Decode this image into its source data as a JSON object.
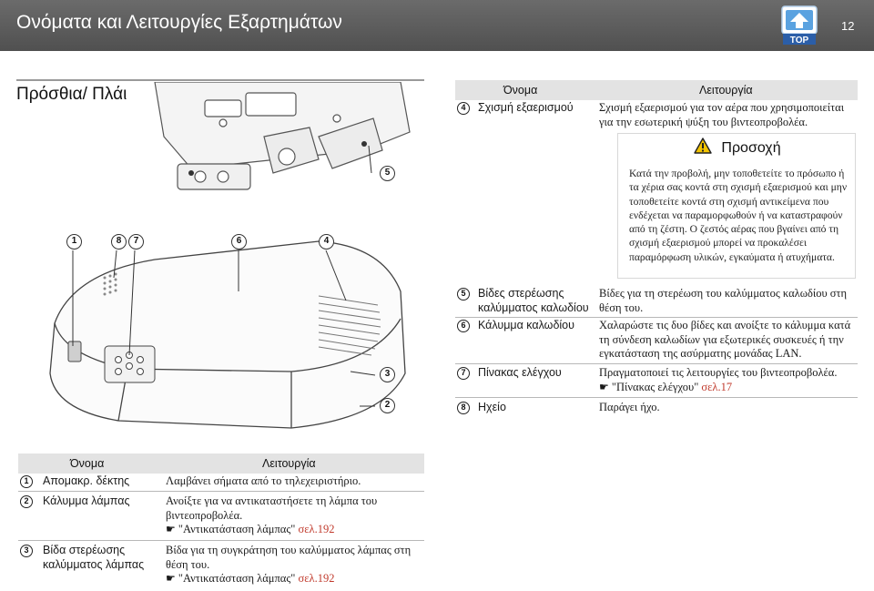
{
  "header": {
    "title": "Ονόματα και Λειτουργίες Εξαρτημάτων",
    "page_number": "12",
    "top_button_label": "TOP",
    "top_icon": "top-arrow-icon"
  },
  "section": {
    "title": "Πρόσθια/ Πλάι"
  },
  "figure": {
    "callouts": [
      "1",
      "8",
      "7",
      "6",
      "4",
      "5",
      "3",
      "2"
    ]
  },
  "right_table": {
    "header_name": "Όνομα",
    "header_function": "Λειτουργία",
    "rows": [
      {
        "num": "4",
        "name": "Σχισμή εξαερισμού",
        "func": "Σχισμή εξαερισμού για τον αέρα που χρησιμοποιείται για την εσωτερική ψύξη του βιντεοπροβολέα."
      },
      {
        "num": "5",
        "name": "Βίδες στερέωσης καλύμματος καλωδίου",
        "func": "Βίδες για τη στερέωση του καλύμματος καλωδίου στη θέση του."
      },
      {
        "num": "6",
        "name": "Κάλυμμα καλωδίου",
        "func": "Χαλαρώστε τις δυο βίδες και ανοίξτε το κάλυμμα κατά τη σύνδεση καλωδίων για εξωτερικές συσκευές ή την εγκατάσταση της ασύρματης μονάδας LAN."
      },
      {
        "num": "7",
        "name": "Πίνακας ελέγχου",
        "func": "Πραγματοποιεί τις λειτουργίες του βιντεοπροβολέα.",
        "ref_text": "\"Πίνακας ελέγχου\"",
        "ref_link": "σελ.17"
      },
      {
        "num": "8",
        "name": "Ηχείο",
        "func": "Παράγει ήχο."
      }
    ]
  },
  "caution": {
    "title": "Προσοχή",
    "icon": "warning-triangle-icon",
    "text": "Κατά την προβολή, μην τοποθετείτε το πρόσωπο ή τα χέρια σας κοντά στη σχισμή εξαερισμού και μην τοποθετείτε κοντά στη σχισμή αντικείμενα που ενδέχεται να παραμορφωθούν ή να καταστραφούν από τη ζέστη. Ο ζεστός αέρας που βγαίνει από τη σχισμή εξαερισμού μπορεί να προκαλέσει παραμόρφωση υλικών, εγκαύματα ή ατυχήματα."
  },
  "bottom_table": {
    "header_name": "Όνομα",
    "header_function": "Λειτουργία",
    "rows": [
      {
        "num": "1",
        "name": "Απομακρ. δέκτης",
        "func": "Λαμβάνει σήματα από το τηλεχειριστήριο."
      },
      {
        "num": "2",
        "name": "Κάλυμμα λάμπας",
        "func": "Ανοίξτε για να αντικαταστήσετε τη λάμπα του βιντεοπροβολέα.",
        "ref_text": "\"Αντικατάσταση λάμπας\"",
        "ref_link": "σελ.192"
      },
      {
        "num": "3",
        "name": "Βίδα στερέωσης καλύμματος λάμπας",
        "func": "Βίδα για τη συγκράτηση του καλύμματος λάμπας στη θέση του.",
        "ref_text": "\"Αντικατάσταση λάμπας\"",
        "ref_link": "σελ.192"
      }
    ]
  },
  "reference_icon": "pointing-hand-icon",
  "colors": {
    "header_bg": "#5c5c5c",
    "table_header_bg": "#e3e3e3",
    "link": "#c0392b",
    "warning_yellow": "#f2c300"
  }
}
